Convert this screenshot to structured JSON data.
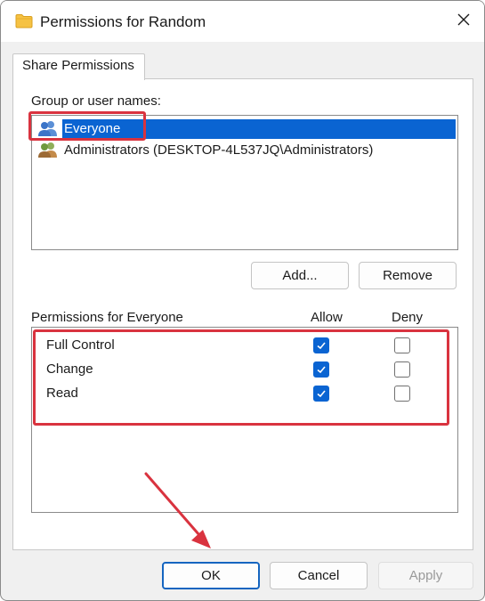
{
  "window": {
    "title": "Permissions for Random",
    "icon": "folder-icon",
    "close_icon": "close-icon"
  },
  "tabs": [
    {
      "label": "Share Permissions",
      "active": true
    }
  ],
  "group_section": {
    "label": "Group or user names:",
    "items": [
      {
        "name": "Everyone",
        "icon": "users-icon",
        "selected": true
      },
      {
        "name": "Administrators (DESKTOP-4L537JQ\\Administrators)",
        "icon": "admin-users-icon",
        "selected": false
      }
    ],
    "add_label": "Add...",
    "remove_label": "Remove"
  },
  "permissions_section": {
    "label": "Permissions for Everyone",
    "allow_header": "Allow",
    "deny_header": "Deny",
    "rows": [
      {
        "name": "Full Control",
        "allow": true,
        "deny": false
      },
      {
        "name": "Change",
        "allow": true,
        "deny": false
      },
      {
        "name": "Read",
        "allow": true,
        "deny": false
      }
    ]
  },
  "footer": {
    "ok_label": "OK",
    "cancel_label": "Cancel",
    "apply_label": "Apply",
    "apply_enabled": false
  },
  "colors": {
    "selection": "#0a64d2",
    "annotation": "#d9333f",
    "primary_border": "#1565c0"
  }
}
